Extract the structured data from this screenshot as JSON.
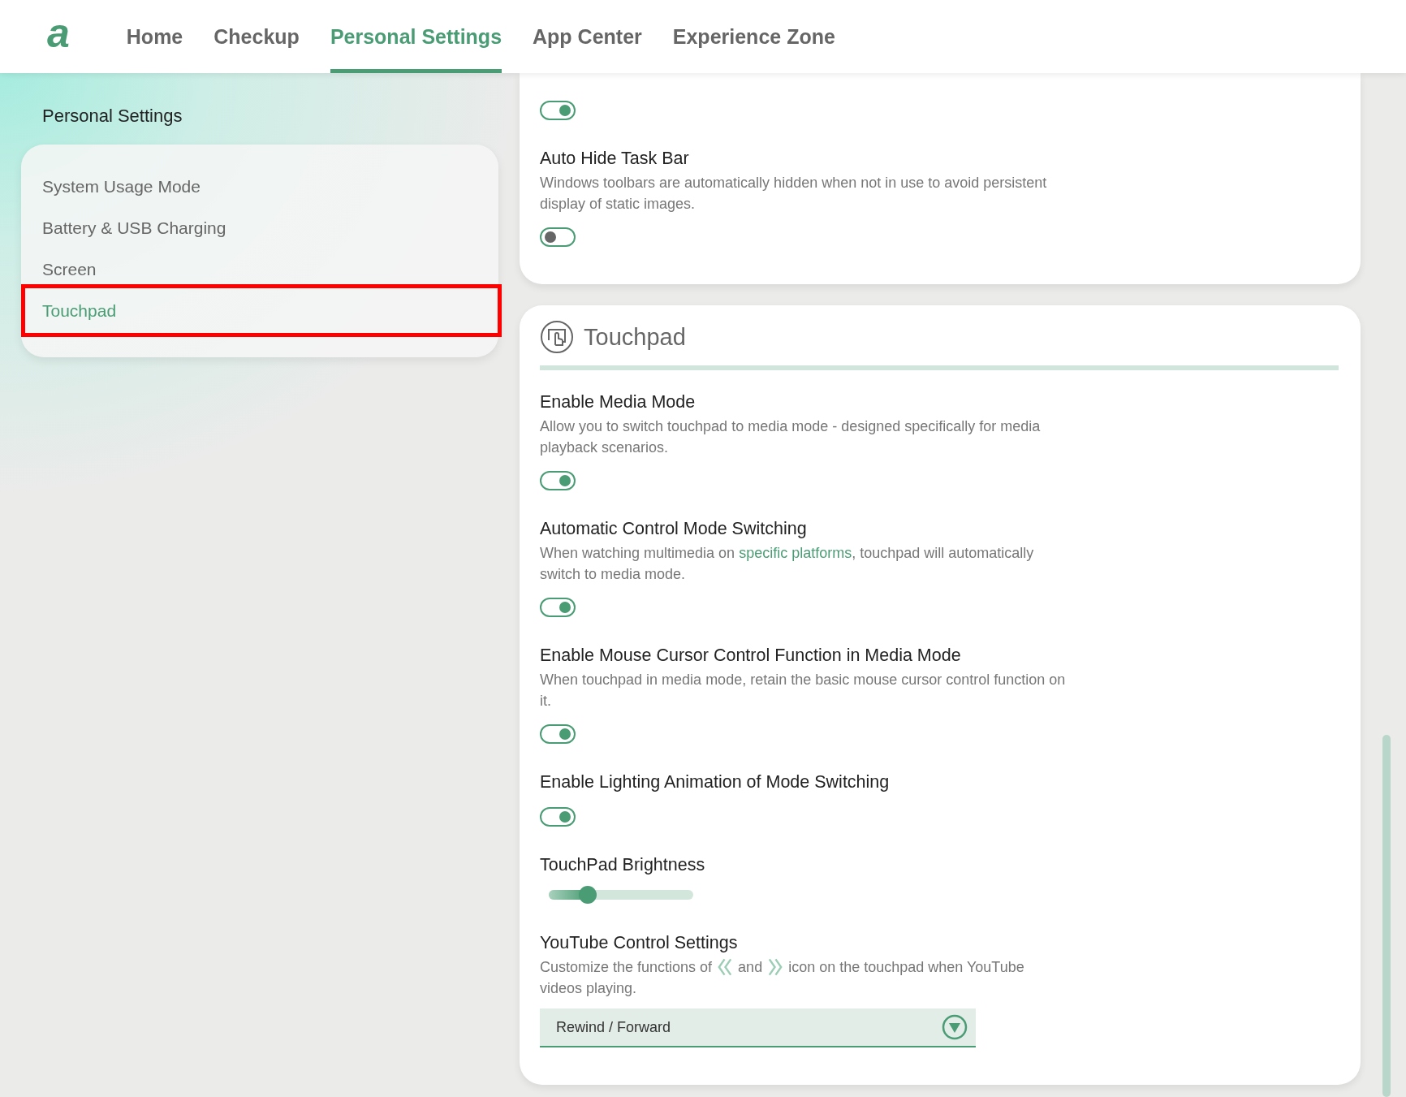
{
  "logo": "a",
  "nav": {
    "tabs": [
      {
        "label": "Home",
        "selected": false
      },
      {
        "label": "Checkup",
        "selected": false
      },
      {
        "label": "Personal Settings",
        "selected": true
      },
      {
        "label": "App Center",
        "selected": false
      },
      {
        "label": "Experience Zone",
        "selected": false
      }
    ]
  },
  "sidebar": {
    "title": "Personal Settings",
    "items": [
      {
        "label": "System Usage Mode",
        "selected": false,
        "highlighted": false
      },
      {
        "label": "Battery & USB Charging",
        "selected": false,
        "highlighted": false
      },
      {
        "label": "Screen",
        "selected": false,
        "highlighted": false
      },
      {
        "label": "Touchpad",
        "selected": true,
        "highlighted": true
      }
    ]
  },
  "sections": [
    {
      "settings": [
        {
          "kind": "toggle",
          "on": true
        },
        {
          "kind": "toggle",
          "title": "Auto Hide Task Bar",
          "description": [
            {
              "kind": "text",
              "text": "Windows toolbars are automatically hidden when not in use to avoid persistent display of static images."
            }
          ],
          "on": false
        }
      ]
    },
    {
      "title": "Touchpad",
      "settings": [
        {
          "kind": "toggle",
          "title": "Enable Media Mode",
          "description": [
            {
              "kind": "text",
              "text": "Allow you to switch touchpad to media mode - designed specifically for media playback scenarios."
            }
          ],
          "on": true
        },
        {
          "kind": "toggle",
          "title": "Automatic Control Mode Switching",
          "description": [
            {
              "kind": "text",
              "text": "When watching multimedia on "
            },
            {
              "kind": "link",
              "text": "specific platforms"
            },
            {
              "kind": "text",
              "text": ", touchpad will automatically switch to media mode."
            }
          ],
          "on": true
        },
        {
          "kind": "toggle",
          "title": "Enable Mouse Cursor Control Function in Media Mode",
          "description": [
            {
              "kind": "text",
              "text": "When touchpad in media mode, retain the basic mouse cursor control function on it."
            }
          ],
          "on": true
        },
        {
          "kind": "toggle",
          "title": "Enable Lighting Animation of Mode Switching",
          "on": true
        },
        {
          "kind": "slider",
          "title": "TouchPad Brightness",
          "level": 0.27
        },
        {
          "kind": "dropdown",
          "title": "YouTube Control Settings",
          "description": [
            {
              "kind": "text",
              "text": "Customize the functions of "
            },
            {
              "kind": "rewind"
            },
            {
              "kind": "text",
              "text": " and "
            },
            {
              "kind": "forward"
            },
            {
              "kind": "text",
              "text": " icon on the touchpad when YouTube videos playing."
            }
          ],
          "value": "Rewind / Forward"
        }
      ]
    }
  ]
}
